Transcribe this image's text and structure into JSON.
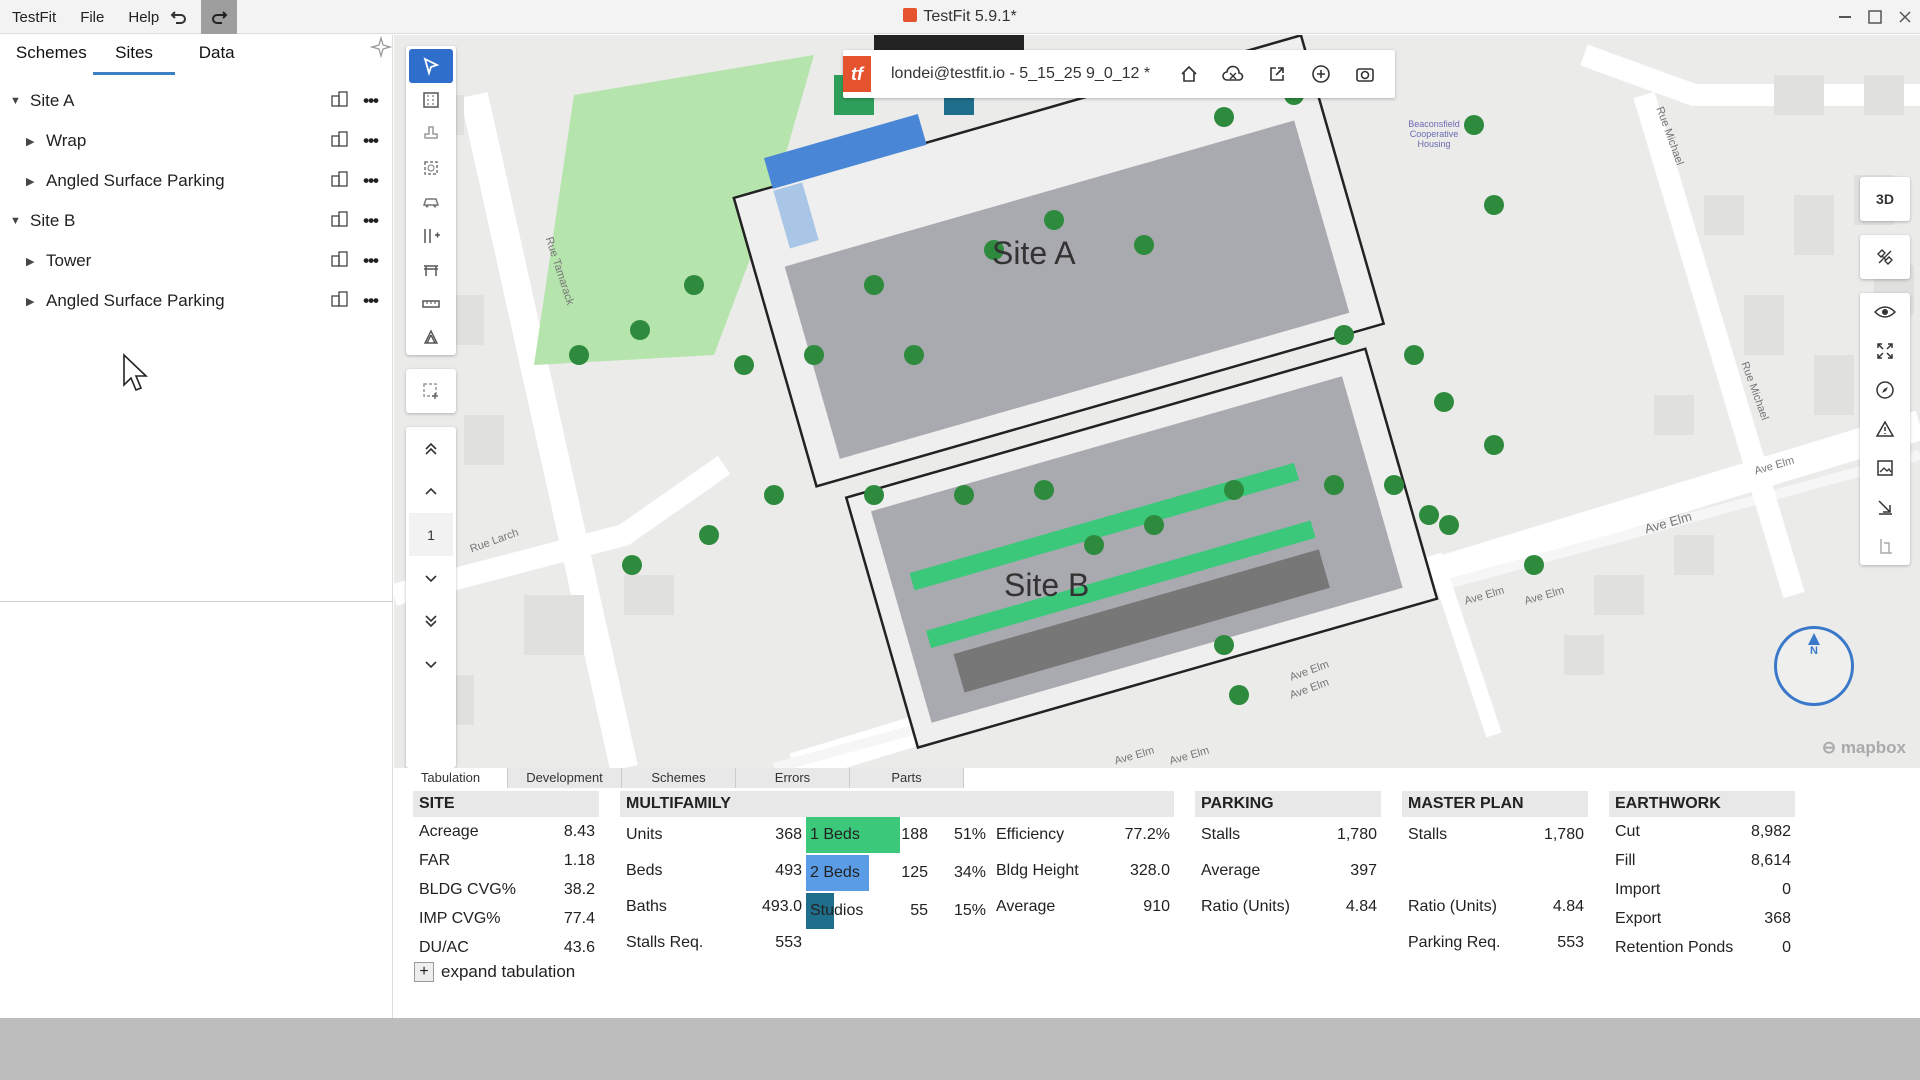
{
  "titlebar": {
    "menu": [
      "TestFit",
      "File",
      "Help"
    ],
    "title": "TestFit 5.9.1*"
  },
  "left_panel": {
    "tabs": [
      "Schemes",
      "Sites",
      "Data"
    ],
    "active_tab": "Sites",
    "tree": [
      {
        "label": "Site A",
        "level": 0
      },
      {
        "label": "Wrap",
        "level": 1
      },
      {
        "label": "Angled Surface Parking",
        "level": 1
      },
      {
        "label": "Site B",
        "level": 0
      },
      {
        "label": "Tower",
        "level": 1
      },
      {
        "label": "Angled Surface Parking",
        "level": 1
      }
    ]
  },
  "project_bar": {
    "name": "londei@testfit.io - 5_15_25 9_0_12 *"
  },
  "left_tools": {
    "page_number": "1"
  },
  "right_tools": {
    "view_toggle": "3D"
  },
  "map": {
    "site_a": "Site A",
    "site_b": "Site B",
    "compass": "N",
    "attribution": "mapbox",
    "labels": {
      "rue_tamarack": "Rue Tamarack",
      "rue_larch": "Rue Larch",
      "rue_michael": "Rue Michael",
      "rue_michael2": "Rue Michael",
      "ave_elm1": "Ave Elm",
      "ave_elm2": "Ave Elm",
      "ave_elm3": "Ave Elm",
      "ave_elm4": "Ave Elm",
      "ave_elm5": "Ave Elm",
      "ave_elm6": "Ave Elm",
      "ave_elm7": "Ave Elm",
      "ave_elm8": "Ave Elm",
      "coop": "Beaconsfield Cooperative Housing"
    }
  },
  "bottom_tabs": [
    "Tabulation",
    "Development",
    "Schemes",
    "Errors",
    "Parts"
  ],
  "tabulation": {
    "site": {
      "header": "SITE",
      "rows": [
        [
          "Acreage",
          "8.43"
        ],
        [
          "FAR",
          "1.18"
        ],
        [
          "BLDG CVG%",
          "38.2"
        ],
        [
          "IMP CVG%",
          "77.4"
        ],
        [
          "DU/AC",
          "43.6"
        ]
      ]
    },
    "multifamily": {
      "header": "MULTIFAMILY",
      "rows": [
        [
          "Units",
          "368"
        ],
        [
          "Beds",
          "493"
        ],
        [
          "Baths",
          "493.0"
        ],
        [
          "Stalls Req.",
          "553"
        ]
      ],
      "mix": [
        {
          "label": "1 Beds",
          "count": "188",
          "pct": "51%",
          "color": "#3cc87a",
          "share": 0.51
        },
        {
          "label": "2 Beds",
          "count": "125",
          "pct": "34%",
          "color": "#5b9ce6",
          "share": 0.34
        },
        {
          "label": "Studios",
          "count": "55",
          "pct": "15%",
          "color": "#1e6e8c",
          "share": 0.15
        }
      ],
      "right_rows": [
        [
          "Efficiency",
          "77.2%"
        ],
        [
          "Bldg Height",
          "328.0"
        ],
        [
          "Average",
          "910"
        ]
      ]
    },
    "parking": {
      "header": "PARKING",
      "rows": [
        [
          "Stalls",
          "1,780"
        ],
        [
          "Average",
          "397"
        ],
        [
          "Ratio (Units)",
          "4.84"
        ]
      ]
    },
    "master_plan": {
      "header": "MASTER PLAN",
      "rows": [
        [
          "Stalls",
          "1,780"
        ],
        [
          "",
          ""
        ],
        [
          "Ratio (Units)",
          "4.84"
        ],
        [
          "Parking Req.",
          "553"
        ]
      ]
    },
    "earthwork": {
      "header": "EARTHWORK",
      "rows": [
        [
          "Cut",
          "8,982"
        ],
        [
          "Fill",
          "8,614"
        ],
        [
          "Import",
          "0"
        ],
        [
          "Export",
          "368"
        ],
        [
          "Retention Ponds",
          "0"
        ]
      ]
    },
    "expand_label": "expand tabulation"
  }
}
